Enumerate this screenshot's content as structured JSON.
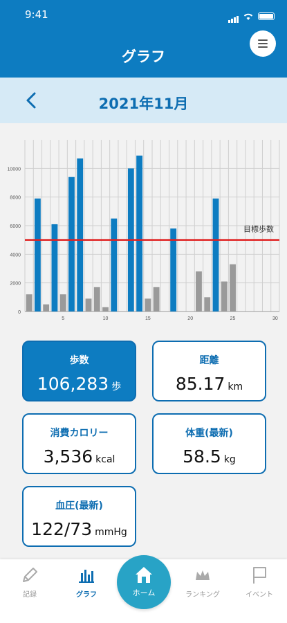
{
  "status": {
    "time": "9:41"
  },
  "header": {
    "title": "グラフ"
  },
  "month_bar": {
    "label": "2021年11月"
  },
  "chart_data": {
    "type": "bar",
    "x": [
      1,
      2,
      3,
      4,
      5,
      6,
      7,
      8,
      9,
      10,
      11,
      12,
      13,
      14,
      15,
      16,
      17,
      18,
      19,
      20,
      21,
      22,
      23,
      24,
      25,
      26,
      27,
      28,
      29,
      30
    ],
    "x_ticks": [
      "5",
      "10",
      "15",
      "20",
      "25",
      "30"
    ],
    "y_ticks": [
      "0",
      "2000",
      "4000",
      "6000",
      "8000",
      "10000"
    ],
    "ylim": [
      0,
      12000
    ],
    "series": [
      {
        "color": "#0d7cc1",
        "values": [
          0,
          7900,
          0,
          6100,
          0,
          9400,
          10700,
          0,
          0,
          0,
          6500,
          0,
          10000,
          10900,
          0,
          0,
          0,
          5800,
          0,
          0,
          0,
          0,
          7900,
          0,
          0,
          0,
          0,
          0,
          0,
          0
        ]
      },
      {
        "color": "#9a9a9a",
        "values": [
          1200,
          0,
          500,
          0,
          1200,
          0,
          0,
          900,
          1700,
          300,
          0,
          0,
          0,
          0,
          900,
          1700,
          0,
          0,
          0,
          0,
          2800,
          1000,
          0,
          2100,
          3300,
          0,
          0,
          0,
          0,
          0
        ]
      }
    ],
    "target": {
      "value": 5000,
      "label": "目標歩数",
      "color": "#e02020"
    },
    "grid": true
  },
  "cards": {
    "steps": {
      "label": "歩数",
      "value": "106,283",
      "unit": "歩"
    },
    "distance": {
      "label": "距離",
      "value": "85.17",
      "unit": "km"
    },
    "calories": {
      "label": "消費カロリー",
      "value": "3,536",
      "unit": "kcal"
    },
    "weight": {
      "label": "体重(最新)",
      "value": "58.5",
      "unit": "kg"
    },
    "blood_pressure": {
      "label": "血圧(最新)",
      "value": "122/73",
      "unit": "mmHg"
    }
  },
  "tabbar": {
    "record": "記録",
    "graph": "グラフ",
    "home": "ホーム",
    "ranking": "ランキング",
    "event": "イベント"
  },
  "icons": [
    "menu-icon",
    "back-chevron-icon",
    "pencil-icon",
    "bar-chart-icon",
    "home-icon",
    "crown-icon",
    "flag-icon"
  ]
}
